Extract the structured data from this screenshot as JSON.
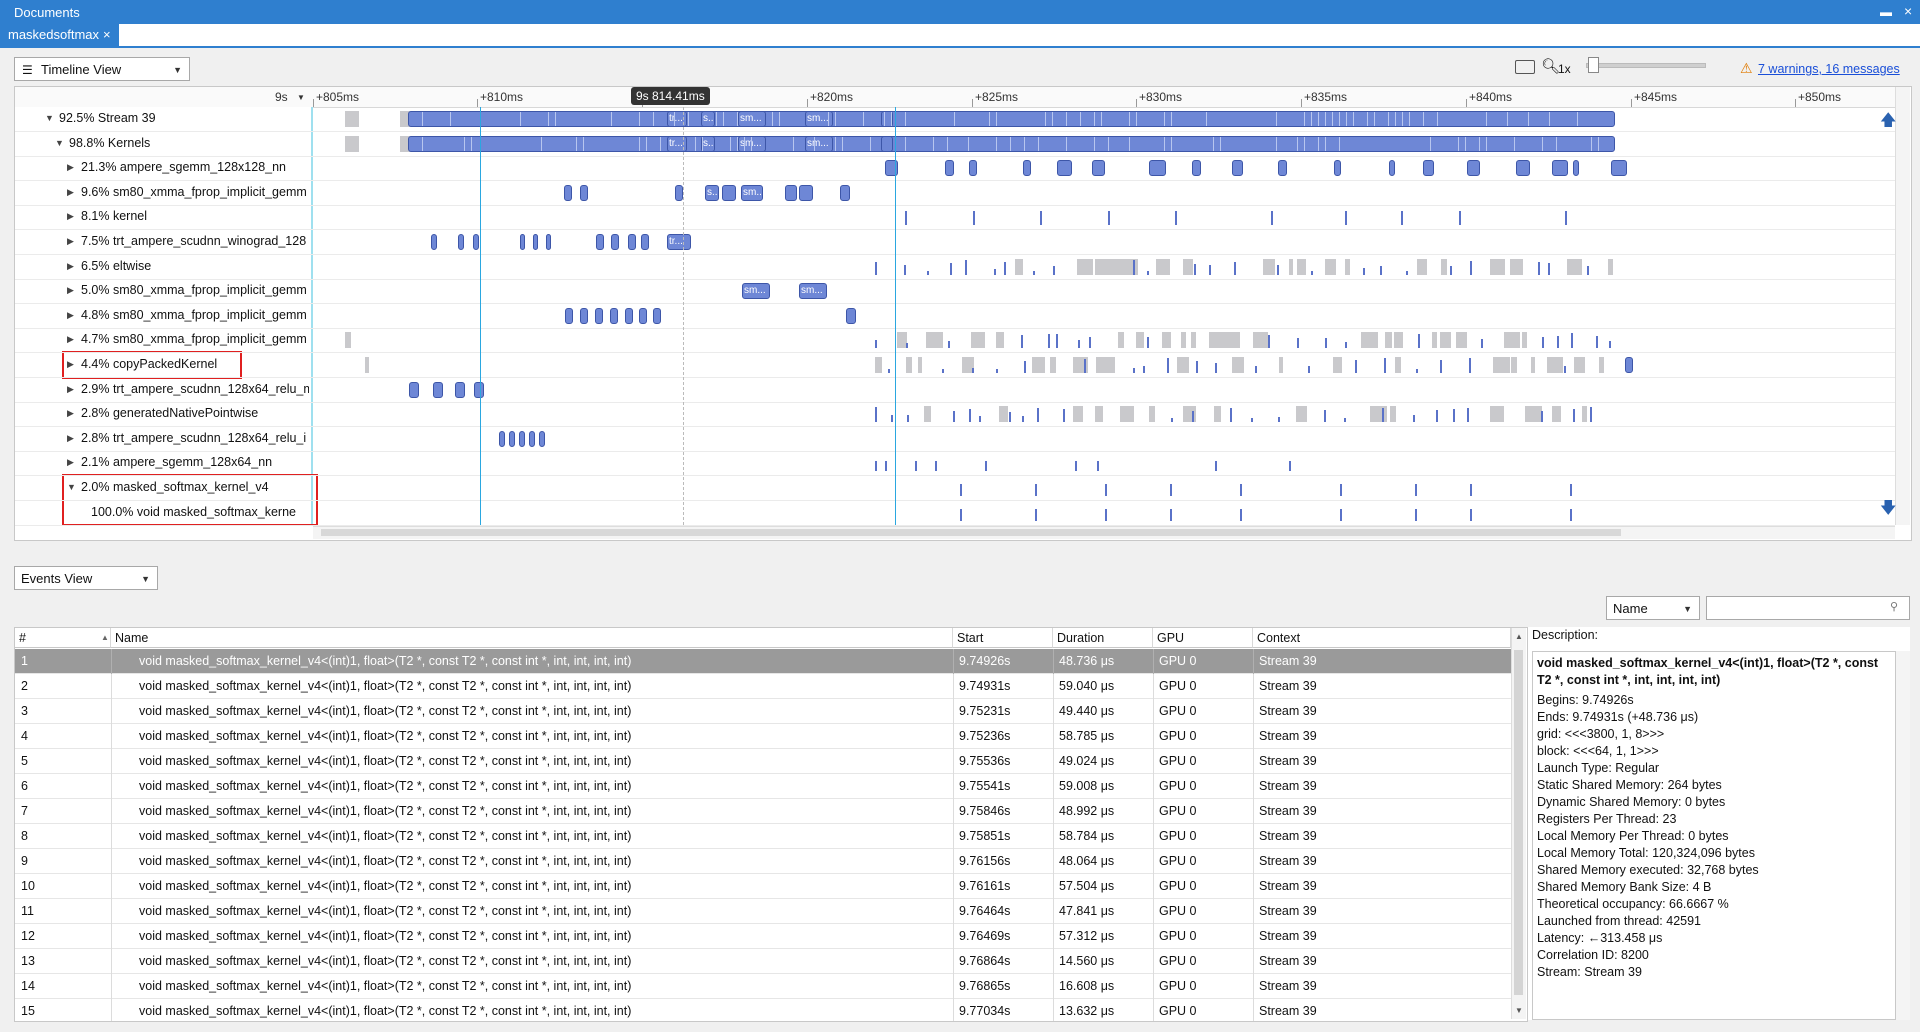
{
  "window": {
    "title": "Documents",
    "tab_label": "maskedsoftmax",
    "tab_close": "×",
    "pin": "▬",
    "close": "×"
  },
  "toolbar": {
    "view_label": "Timeline View",
    "zoom_level": "1x",
    "warnings_link": "7 warnings, 16 messages",
    "zoom_slider_value": 0.02
  },
  "ruler": {
    "origin_label": "9s",
    "ticks": [
      "+805ms",
      "+810ms",
      "+815ms",
      "+820ms",
      "+825ms",
      "+830ms",
      "+835ms",
      "+840ms",
      "+845ms",
      "+850ms"
    ],
    "cursor_tooltip": "9s 814.41ms"
  },
  "tree_rows": [
    {
      "label": "92.5% Stream 39",
      "expanded": true
    },
    {
      "label": "98.8% Kernels",
      "expanded": true
    },
    {
      "label": "21.3% ampere_sgemm_128x128_nn",
      "expanded": false
    },
    {
      "label": "9.6% sm80_xmma_fprop_implicit_gemm",
      "expanded": false
    },
    {
      "label": "8.1% kernel",
      "expanded": false
    },
    {
      "label": "7.5% trt_ampere_scudnn_winograd_128",
      "expanded": false
    },
    {
      "label": "6.5% eltwise",
      "expanded": false
    },
    {
      "label": "5.0% sm80_xmma_fprop_implicit_gemm",
      "expanded": false
    },
    {
      "label": "4.8% sm80_xmma_fprop_implicit_gemm",
      "expanded": false
    },
    {
      "label": "4.7% sm80_xmma_fprop_implicit_gemm",
      "expanded": false
    },
    {
      "label": "4.4% copyPackedKernel",
      "expanded": false
    },
    {
      "label": "2.9% trt_ampere_scudnn_128x64_relu_m",
      "expanded": false
    },
    {
      "label": "2.8% generatedNativePointwise",
      "expanded": false
    },
    {
      "label": "2.8% trt_ampere_scudnn_128x64_relu_i",
      "expanded": false
    },
    {
      "label": "2.1% ampere_sgemm_128x64_nn",
      "expanded": false
    },
    {
      "label": "2.0% masked_softmax_kernel_v4",
      "expanded": true
    },
    {
      "label": "100.0% void masked_softmax_kerne",
      "expanded": false
    }
  ],
  "bar_labels": {
    "tr": "tr...",
    "s": "s...",
    "sm": "sm..."
  },
  "events_view": {
    "view_label": "Events View",
    "filter_field": "Name",
    "search_placeholder": "",
    "columns": [
      "#",
      "Name",
      "Start",
      "Duration",
      "GPU",
      "Context"
    ],
    "rows": [
      {
        "n": "1",
        "name": "void masked_softmax_kernel_v4<(int)1, float>(T2 *, const T2 *, const int *, int, int, int, int)",
        "start": "9.74926s",
        "dur": "48.736 μs",
        "gpu": "GPU 0",
        "ctx": "Stream 39"
      },
      {
        "n": "2",
        "name": "void masked_softmax_kernel_v4<(int)1, float>(T2 *, const T2 *, const int *, int, int, int, int)",
        "start": "9.74931s",
        "dur": "59.040 μs",
        "gpu": "GPU 0",
        "ctx": "Stream 39"
      },
      {
        "n": "3",
        "name": "void masked_softmax_kernel_v4<(int)1, float>(T2 *, const T2 *, const int *, int, int, int, int)",
        "start": "9.75231s",
        "dur": "49.440 μs",
        "gpu": "GPU 0",
        "ctx": "Stream 39"
      },
      {
        "n": "4",
        "name": "void masked_softmax_kernel_v4<(int)1, float>(T2 *, const T2 *, const int *, int, int, int, int)",
        "start": "9.75236s",
        "dur": "58.785 μs",
        "gpu": "GPU 0",
        "ctx": "Stream 39"
      },
      {
        "n": "5",
        "name": "void masked_softmax_kernel_v4<(int)1, float>(T2 *, const T2 *, const int *, int, int, int, int)",
        "start": "9.75536s",
        "dur": "49.024 μs",
        "gpu": "GPU 0",
        "ctx": "Stream 39"
      },
      {
        "n": "6",
        "name": "void masked_softmax_kernel_v4<(int)1, float>(T2 *, const T2 *, const int *, int, int, int, int)",
        "start": "9.75541s",
        "dur": "59.008 μs",
        "gpu": "GPU 0",
        "ctx": "Stream 39"
      },
      {
        "n": "7",
        "name": "void masked_softmax_kernel_v4<(int)1, float>(T2 *, const T2 *, const int *, int, int, int, int)",
        "start": "9.75846s",
        "dur": "48.992 μs",
        "gpu": "GPU 0",
        "ctx": "Stream 39"
      },
      {
        "n": "8",
        "name": "void masked_softmax_kernel_v4<(int)1, float>(T2 *, const T2 *, const int *, int, int, int, int)",
        "start": "9.75851s",
        "dur": "58.784 μs",
        "gpu": "GPU 0",
        "ctx": "Stream 39"
      },
      {
        "n": "9",
        "name": "void masked_softmax_kernel_v4<(int)1, float>(T2 *, const T2 *, const int *, int, int, int, int)",
        "start": "9.76156s",
        "dur": "48.064 μs",
        "gpu": "GPU 0",
        "ctx": "Stream 39"
      },
      {
        "n": "10",
        "name": "void masked_softmax_kernel_v4<(int)1, float>(T2 *, const T2 *, const int *, int, int, int, int)",
        "start": "9.76161s",
        "dur": "57.504 μs",
        "gpu": "GPU 0",
        "ctx": "Stream 39"
      },
      {
        "n": "11",
        "name": "void masked_softmax_kernel_v4<(int)1, float>(T2 *, const T2 *, const int *, int, int, int, int)",
        "start": "9.76464s",
        "dur": "47.841 μs",
        "gpu": "GPU 0",
        "ctx": "Stream 39"
      },
      {
        "n": "12",
        "name": "void masked_softmax_kernel_v4<(int)1, float>(T2 *, const T2 *, const int *, int, int, int, int)",
        "start": "9.76469s",
        "dur": "57.312 μs",
        "gpu": "GPU 0",
        "ctx": "Stream 39"
      },
      {
        "n": "13",
        "name": "void masked_softmax_kernel_v4<(int)1, float>(T2 *, const T2 *, const int *, int, int, int, int)",
        "start": "9.76864s",
        "dur": "14.560 μs",
        "gpu": "GPU 0",
        "ctx": "Stream 39"
      },
      {
        "n": "14",
        "name": "void masked_softmax_kernel_v4<(int)1, float>(T2 *, const T2 *, const int *, int, int, int, int)",
        "start": "9.76865s",
        "dur": "16.608 μs",
        "gpu": "GPU 0",
        "ctx": "Stream 39"
      },
      {
        "n": "15",
        "name": "void masked_softmax_kernel_v4<(int)1, float>(T2 *, const T2 *, const int *, int, int, int, int)",
        "start": "9.77034s",
        "dur": "13.632 μs",
        "gpu": "GPU 0",
        "ctx": "Stream 39"
      }
    ]
  },
  "description": {
    "heading": "Description:",
    "title": "void masked_softmax_kernel_v4<(int)1, float>(T2 *, const T2 *, const int *, int, int, int, int)",
    "lines": [
      "Begins: 9.74926s",
      "Ends: 9.74931s (+48.736 μs)",
      "grid:  <<<3800, 1, 8>>>",
      "block: <<<64, 1, 1>>>",
      "Launch Type: Regular",
      "Static Shared Memory: 264 bytes",
      "Dynamic Shared Memory: 0 bytes",
      "Registers Per Thread: 23",
      "Local Memory Per Thread: 0 bytes",
      "Local Memory Total: 120,324,096 bytes",
      "Shared Memory executed: 32,768 bytes",
      "Shared Memory Bank Size: 4 B",
      "Theoretical occupancy: 66.6667 %",
      "Launched from thread: 42591",
      "Latency: ←313.458 μs",
      "Correlation ID: 8200",
      "Stream: Stream 39"
    ]
  },
  "colors": {
    "accent": "#2f7fcf",
    "kernel_bar": "#6e87d6",
    "highlight": "#e02020",
    "cursor": "#2aa7e0"
  }
}
